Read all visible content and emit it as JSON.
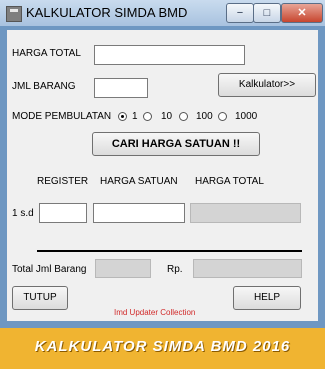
{
  "window": {
    "title": "KALKULATOR SIMDA BMD",
    "minimize_glyph": "−",
    "maximize_glyph": "□",
    "close_glyph": "✕"
  },
  "form": {
    "harga_total_label": "HARGA TOTAL",
    "harga_total_value": "",
    "jml_barang_label": "JML BARANG",
    "jml_barang_value": "",
    "kalkulator_button": "Kalkulator>>",
    "mode_label": "MODE PEMBULATAN",
    "mode_options": [
      {
        "label": "1",
        "selected": true
      },
      {
        "label": "10",
        "selected": false
      },
      {
        "label": "100",
        "selected": false
      },
      {
        "label": "1000",
        "selected": false
      }
    ],
    "cari_button": "CARI HARGA SATUAN !!"
  },
  "table": {
    "headers": [
      "REGISTER",
      "HARGA SATUAN",
      "HARGA TOTAL"
    ],
    "row_label": "1 s.d",
    "register_value": "",
    "harga_satuan_value": "",
    "harga_total_value": ""
  },
  "footer": {
    "total_label": "Total Jml Barang",
    "total_value": "",
    "rp_label": "Rp.",
    "rp_value": "",
    "tutup_button": "TUTUP",
    "help_button": "HELP",
    "watermark": "Imd Updater Collection"
  },
  "banner": "KALKULATOR SIMDA BMD 2016",
  "colors": {
    "background": "#f0b431",
    "window_frame": "#6e97c2",
    "watermark": "#d12a2a"
  }
}
